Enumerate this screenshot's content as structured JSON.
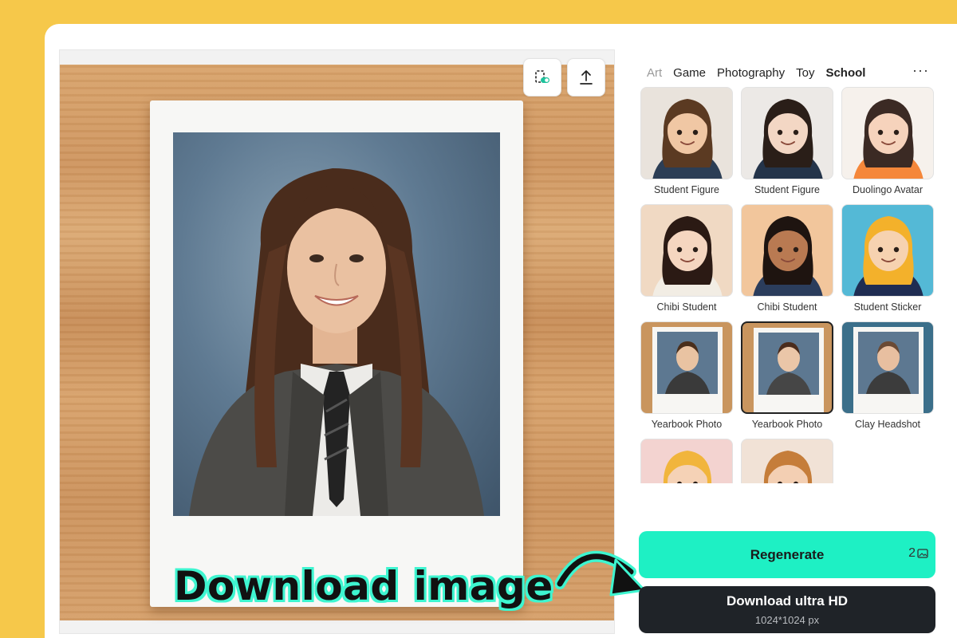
{
  "tabs": [
    {
      "label": "Art",
      "state": "faded"
    },
    {
      "label": "Game",
      "state": "normal"
    },
    {
      "label": "Photography",
      "state": "normal"
    },
    {
      "label": "Toy",
      "state": "normal"
    },
    {
      "label": "School",
      "state": "active"
    }
  ],
  "more_label": "···",
  "styles": [
    {
      "label": "Student Figure",
      "bg": "#e9e3dc",
      "skin": "#f0c7a4",
      "hair": "#5b3a22",
      "shirt": "#2c3e55"
    },
    {
      "label": "Student Figure",
      "bg": "#ece9e6",
      "skin": "#f3d7c4",
      "hair": "#2a1e18",
      "shirt": "#24344a"
    },
    {
      "label": "Duolingo Avatar",
      "bg": "#f6f1ec",
      "skin": "#f6d3bc",
      "hair": "#3b2a24",
      "shirt": "#f5873a"
    },
    {
      "label": "Chibi Student",
      "bg": "#f0d9c3",
      "skin": "#f5d6c0",
      "hair": "#2b1a14",
      "shirt": "#f2ede4"
    },
    {
      "label": "Chibi Student",
      "bg": "#f2c69c",
      "skin": "#b97a52",
      "hair": "#1e1410",
      "shirt": "#2b3d5c"
    },
    {
      "label": "Student Sticker",
      "bg": "#54b9d6",
      "skin": "#f6d2b0",
      "hair": "#f3b12b",
      "shirt": "#1f2d52"
    },
    {
      "label": "Yearbook Photo",
      "bg": "#c9955e",
      "skin": "#e9c3a2",
      "hair": "#4a2f1c",
      "shirt": "#3a3a3a"
    },
    {
      "label": "Yearbook Photo",
      "bg": "#c9955e",
      "skin": "#eac6a8",
      "hair": "#4b2c1c",
      "shirt": "#464646"
    },
    {
      "label": "Clay Headshot",
      "bg": "#3b6f8a",
      "skin": "#e8bfa0",
      "hair": "#6b4a34",
      "shirt": "#3c3c3c"
    },
    {
      "label": "",
      "bg": "#f3d3d0",
      "skin": "#f5d2b6",
      "hair": "#f1b53c",
      "shirt": "#3ec26f"
    },
    {
      "label": "",
      "bg": "#f1e2d6",
      "skin": "#f3cfb3",
      "hair": "#c57d3a",
      "shirt": "#e8a33b"
    }
  ],
  "selected_index": 7,
  "regenerate_label": "Regenerate",
  "credit_count": "2",
  "download_label": "Download ultra HD",
  "download_size": "1024*1024 px",
  "overlay_text": "Download image",
  "colors": {
    "accent": "#1ef0c4",
    "page_bg": "#f6c84a",
    "dark_button": "#1f2328"
  },
  "icons": {
    "compare": "compare-toggle-icon",
    "upload": "upload-icon",
    "credit": "image-credit-icon"
  }
}
